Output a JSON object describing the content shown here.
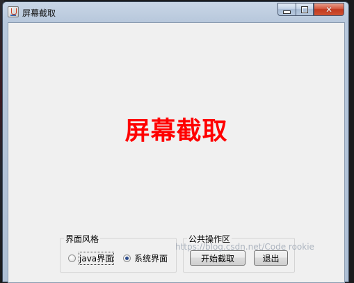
{
  "window": {
    "title": "屏幕截取",
    "icon": "java-cup-icon",
    "caption_close_glyph": "✕"
  },
  "main": {
    "heading": "屏幕截取",
    "heading_color": "#ff0000"
  },
  "style_group": {
    "legend": "界面风格",
    "options": [
      {
        "label": "java界面",
        "selected": false
      },
      {
        "label": "系统界面",
        "selected": true
      }
    ]
  },
  "ops_group": {
    "legend": "公共操作区",
    "start_label": "开始截取",
    "exit_label": "退出"
  },
  "watermark": "https://blog.csdn.net/Code   rookie"
}
